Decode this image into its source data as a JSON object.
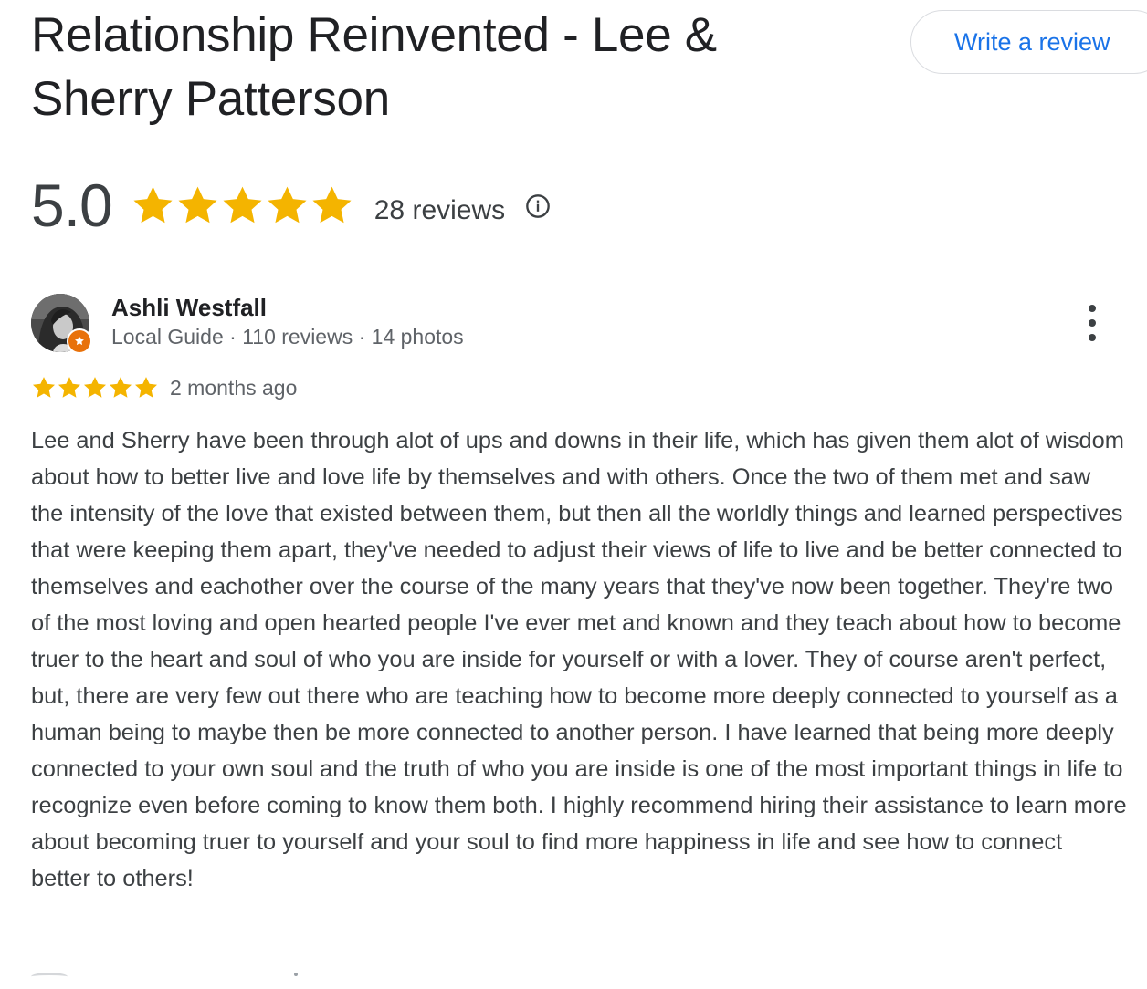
{
  "business": {
    "title": "Relationship Reinvented - Lee & Sherry Patterson"
  },
  "header": {
    "write_review_label": "Write a review"
  },
  "summary": {
    "rating": "5.0",
    "stars": 5,
    "reviews_count": "28 reviews",
    "star_color": "#f4b400"
  },
  "review": {
    "reviewer_name": "Ashli Westfall",
    "reviewer_meta": "Local Guide · 110 reviews · 14 photos",
    "stars": 5,
    "date": "2 months ago",
    "text": "Lee and Sherry have been through alot of ups and downs in their life, which has given them alot of wisdom about how to better live and love life by themselves and with others. Once the two of them met and saw the intensity of the love that existed between them, but then all the worldly things and learned perspectives that were keeping them apart, they've needed to adjust their views of life to live and be better connected to themselves and eachother over the course of the many years that they've now been together. They're two of the most loving and open hearted people I've ever met and known and they teach about how to become truer to the heart and soul of who you are inside for yourself or with a lover. They of course aren't perfect, but, there are very few out there who are teaching how to become more deeply connected to yourself as a human being to maybe then be more connected to another person. I have learned that being more deeply connected to your own soul and the truth of who you are inside is one of the most important things in life to recognize even before coming to know them both. I highly recommend hiring their assistance to learn more about becoming truer to yourself and your soul to find more happiness in life and see how to connect better to others!"
  },
  "icons": {
    "info": "info-icon",
    "more": "more-vert-icon",
    "badge": "local-guide-badge-icon",
    "star": "star-icon"
  },
  "colors": {
    "link_blue": "#1a73e8",
    "badge_orange": "#e8710a",
    "text_dark": "#202124",
    "text_muted": "#5f6368"
  }
}
